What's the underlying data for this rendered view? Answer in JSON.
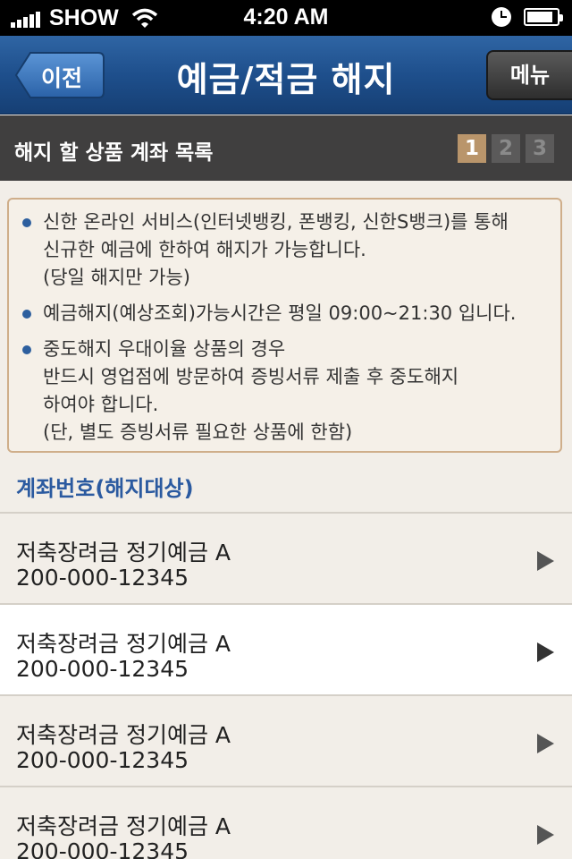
{
  "status": {
    "carrier": "SHOW",
    "time": "4:20 AM"
  },
  "nav": {
    "back_label": "이전",
    "title": "예금/적금  해지",
    "menu_label": "메뉴"
  },
  "section": {
    "title": "해지 할 상품 계좌 목록",
    "steps": [
      "1",
      "2",
      "3"
    ],
    "active_step": 1
  },
  "notice": {
    "items": [
      "신한 온라인 서비스(인터넷뱅킹, 폰뱅킹, 신한S뱅크)를 통해\n신규한 예금에 한하여 해지가 가능합니다.\n(당일 해지만 가능)",
      "예금해지(예상조회)가능시간은 평일 09:00~21:30 입니다.",
      "중도해지 우대이율 상품의 경우\n반드시 영업점에 방문하여 증빙서류 제출 후 중도해지\n하여야 합니다.\n(단, 별도 증빙서류 필요한 상품에 한함)"
    ]
  },
  "account_label": "계좌번호(해지대상)",
  "accounts": [
    {
      "name": "저축장려금 정기예금 A",
      "number": "200-000-12345"
    },
    {
      "name": "저축장려금 정기예금 A",
      "number": "200-000-12345"
    },
    {
      "name": "저축장려금 정기예금 A",
      "number": "200-000-12345"
    },
    {
      "name": "저축장려금 정기예금 A",
      "number": "200-000-12345"
    }
  ],
  "colors": {
    "nav_blue": "#1e4f8c",
    "section_dark": "#403f3f",
    "step_active": "#b9956b",
    "label_blue": "#2b5aa0"
  }
}
